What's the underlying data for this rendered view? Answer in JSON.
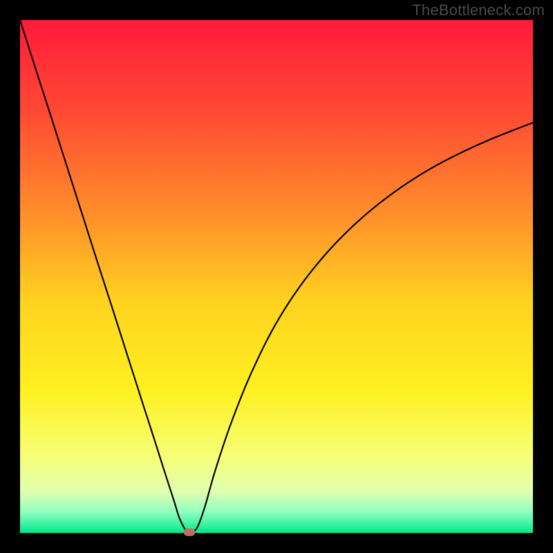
{
  "watermark": "TheBottleneck.com",
  "chart_data": {
    "type": "line",
    "title": "",
    "xlabel": "",
    "ylabel": "",
    "xlim": [
      0,
      100
    ],
    "ylim": [
      0,
      100
    ],
    "gradient_stops": [
      {
        "offset": 0.0,
        "color": "#ff1a3a"
      },
      {
        "offset": 0.18,
        "color": "#ff4a33"
      },
      {
        "offset": 0.38,
        "color": "#ff8f2a"
      },
      {
        "offset": 0.55,
        "color": "#ffd31f"
      },
      {
        "offset": 0.72,
        "color": "#fff01f"
      },
      {
        "offset": 0.85,
        "color": "#f7ff77"
      },
      {
        "offset": 0.92,
        "color": "#e0ffb0"
      },
      {
        "offset": 0.96,
        "color": "#8effc0"
      },
      {
        "offset": 1.0,
        "color": "#00e88a"
      }
    ],
    "series": [
      {
        "name": "bottleneck-curve",
        "x": [
          0.0,
          3.0,
          6.0,
          9.0,
          12.0,
          15.0,
          18.0,
          21.0,
          24.0,
          26.0,
          28.0,
          30.0,
          31.0,
          32.0,
          32.7,
          33.3,
          34.5,
          36.0,
          38.0,
          41.0,
          45.0,
          50.0,
          56.0,
          63.0,
          71.0,
          80.0,
          90.0,
          100.0
        ],
        "y": [
          100.0,
          90.6,
          81.3,
          71.9,
          62.5,
          53.1,
          43.8,
          34.4,
          25.0,
          18.8,
          12.5,
          6.3,
          3.1,
          1.0,
          0.2,
          0.2,
          1.0,
          5.0,
          12.0,
          21.0,
          31.0,
          41.0,
          50.0,
          58.0,
          65.0,
          71.0,
          76.0,
          80.0
        ]
      }
    ],
    "marker": {
      "x": 33.0,
      "y": 0.2,
      "color": "#cc6a5c"
    }
  }
}
